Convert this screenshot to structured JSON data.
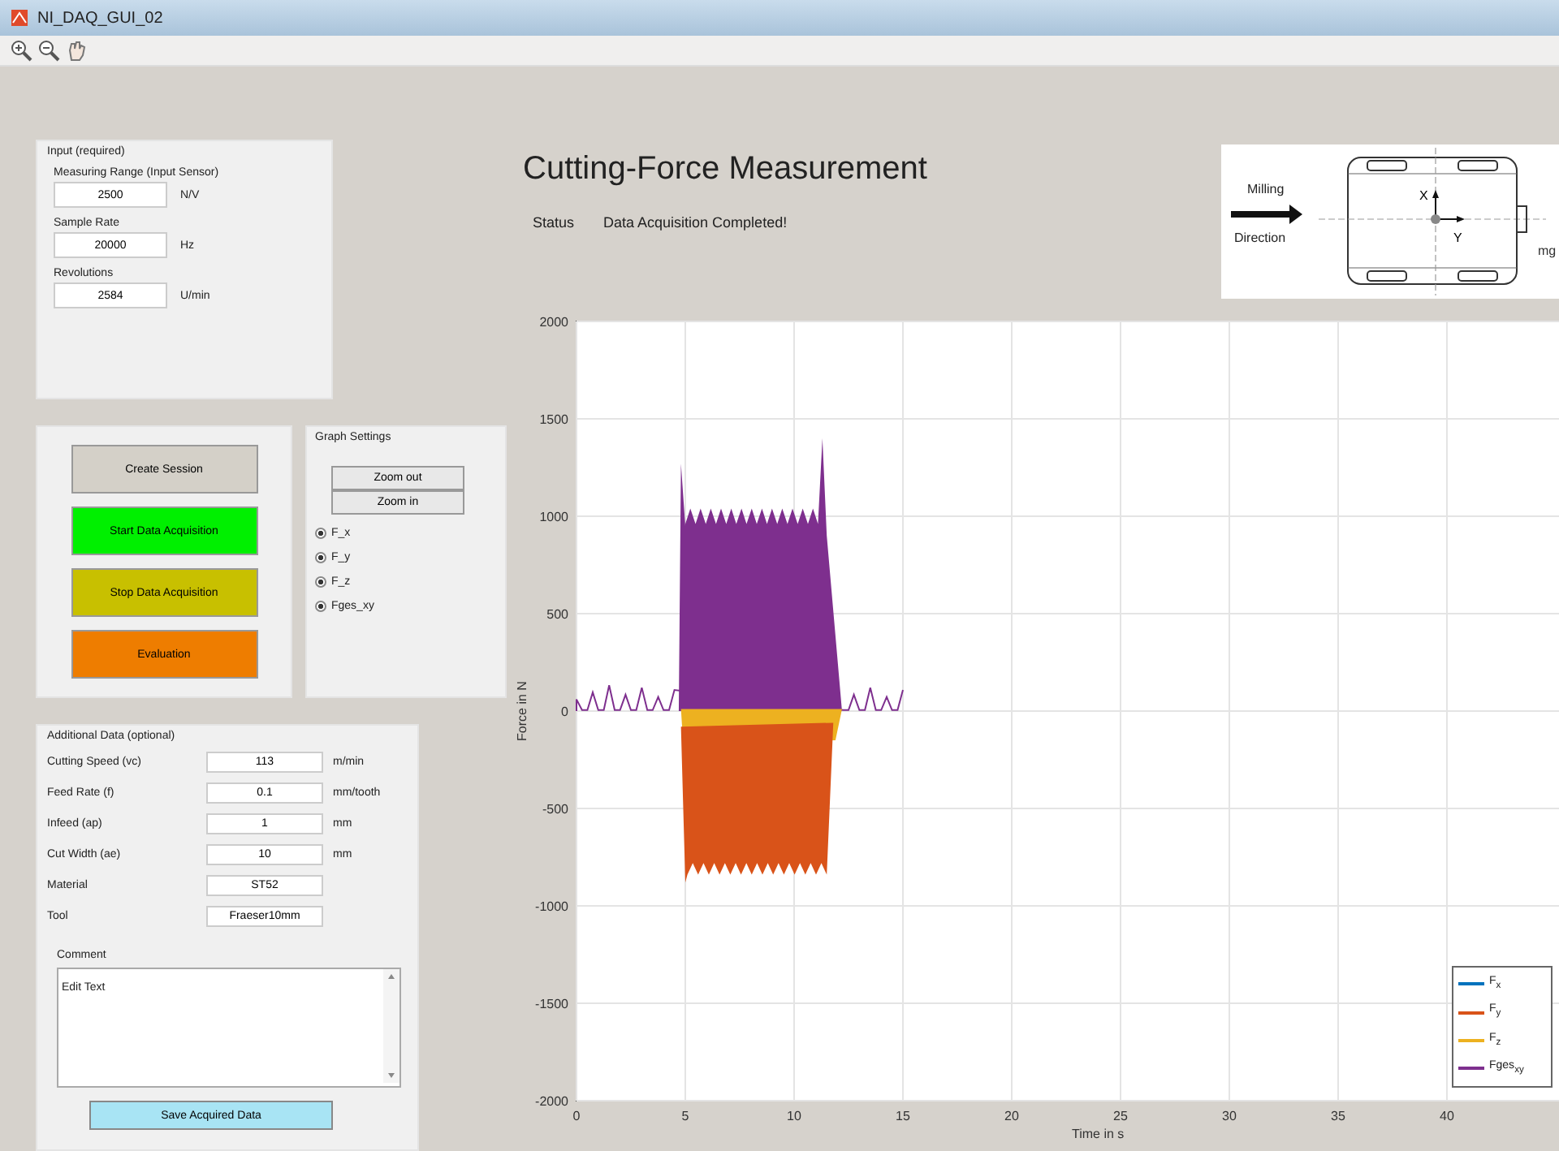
{
  "window": {
    "title": "NI_DAQ_GUI_02"
  },
  "input_panel": {
    "title": "Input (required)",
    "fields": [
      {
        "label": "Measuring Range (Input Sensor)",
        "value": "2500",
        "unit": "N/V"
      },
      {
        "label": "Sample Rate",
        "value": "20000",
        "unit": "Hz"
      },
      {
        "label": "Revolutions",
        "value": "2584",
        "unit": "U/min"
      }
    ]
  },
  "actions": [
    {
      "label": "Create Session",
      "color": "#d4d0c8"
    },
    {
      "label": "Start Data Acquisition",
      "color": "#00f000"
    },
    {
      "label": "Stop Data Acquisition",
      "color": "#c8c000"
    },
    {
      "label": "Evaluation",
      "color": "#ee7d00"
    }
  ],
  "graph_settings": {
    "title": "Graph Settings",
    "buttons": [
      "Zoom out",
      "Zoom in"
    ],
    "options": [
      {
        "label": "F_x",
        "checked": true
      },
      {
        "label": "F_y",
        "checked": true
      },
      {
        "label": "F_z",
        "checked": true
      },
      {
        "label": "Fges_xy",
        "checked": true
      }
    ]
  },
  "additional_panel": {
    "title": "Additional Data (optional)",
    "fields": [
      {
        "label": "Cutting Speed (vc)",
        "value": "113",
        "unit": "m/min"
      },
      {
        "label": "Feed Rate (f)",
        "value": "0.1",
        "unit": "mm/tooth"
      },
      {
        "label": "Infeed (ap)",
        "value": "1",
        "unit": "mm"
      },
      {
        "label": "Cut Width (ae)",
        "value": "10",
        "unit": "mm"
      },
      {
        "label": "Material",
        "value": "ST52"
      },
      {
        "label": "Tool",
        "value": "Fraeser10mm"
      }
    ],
    "comment_label": "Comment",
    "comment": "Edit Text",
    "save_button": "Save Acquired Data"
  },
  "header": {
    "title": "Cutting-Force Measurement",
    "status_label": "Status",
    "status": "Data Acquisition Completed!"
  },
  "diagram": {
    "arrow_label_1": "Milling",
    "arrow_label_2": "Direction",
    "axis_x": "X",
    "axis_y": "Y",
    "side_label": "mg"
  },
  "plot": {
    "ylabel": "Force in N",
    "xlabel": "Time in s",
    "yticks": [
      "2000",
      "1500",
      "1000",
      "500",
      "0",
      "-500",
      "-1000",
      "-1500",
      "-2000"
    ],
    "xticks": [
      "0",
      "5",
      "10",
      "15",
      "20",
      "25",
      "30",
      "35",
      "40"
    ],
    "legend": [
      {
        "name": "F$_{x}$",
        "color": "#0072bd"
      },
      {
        "name": "F$_{y}$",
        "color": "#d95319"
      },
      {
        "name": "F$_{z}$",
        "color": "#edb120"
      },
      {
        "name": "Fges$_{xy}$",
        "color": "#7e2f8e"
      }
    ]
  }
}
